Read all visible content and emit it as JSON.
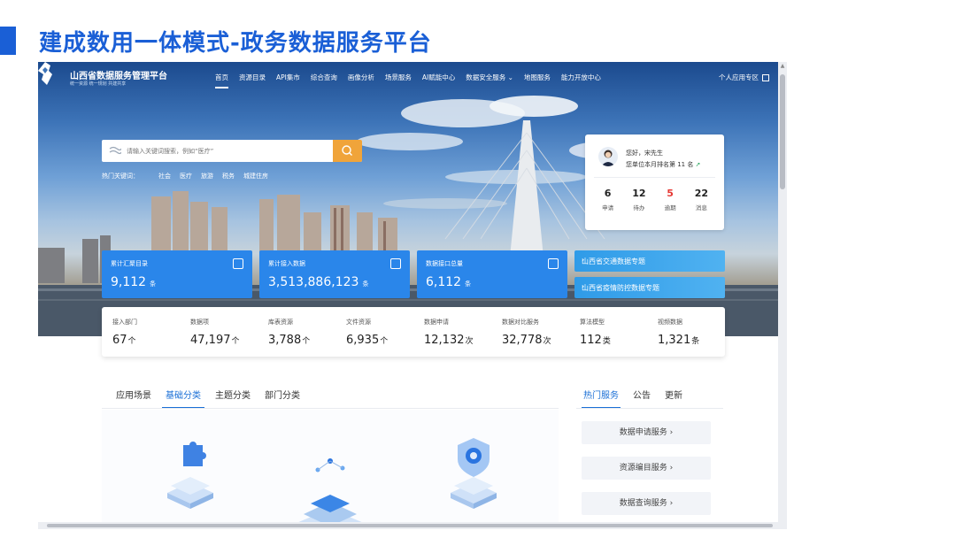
{
  "slide": {
    "title": "建成数用一体模式-政务数据服务平台"
  },
  "app": {
    "name": "山西省数据服务管理平台",
    "slogan": "统一资源 统一规划 共建共享"
  },
  "nav": {
    "items": [
      "首页",
      "资源目录",
      "API集市",
      "综合查询",
      "画像分析",
      "场景服务",
      "AI赋能中心",
      "数据安全服务 ⌄",
      "地图服务",
      "能力开放中心"
    ],
    "active_index": 0,
    "right_label": "个人应用专区"
  },
  "search": {
    "placeholder": "请输入关键词搜索，例如“医疗”",
    "hot_label": "热门关键词：",
    "hot_keywords": [
      "社会",
      "医疗",
      "旅游",
      "税务",
      "城建住房"
    ]
  },
  "user": {
    "greeting": "您好，宋先生",
    "rank_text": "您单位本月排名第 11 名",
    "stats": [
      {
        "value": "6",
        "label": "申请"
      },
      {
        "value": "12",
        "label": "待办"
      },
      {
        "value": "5",
        "label": "逾期"
      },
      {
        "value": "22",
        "label": "消息"
      }
    ]
  },
  "stat_cards": [
    {
      "label": "累计汇聚目录",
      "value": "9,112",
      "unit": "条",
      "icon": "grid-icon"
    },
    {
      "label": "累计接入数据",
      "value": "3,513,886,123",
      "unit": "条",
      "icon": "database-icon"
    },
    {
      "label": "数据接口总量",
      "value": "6,112",
      "unit": "条",
      "icon": "api-icon"
    }
  ],
  "topics": [
    {
      "label": "山西省交通数据专题"
    },
    {
      "label": "山西省疫情防控数据专题"
    }
  ],
  "metrics": [
    {
      "label": "接入部门",
      "value": "67",
      "unit": "个"
    },
    {
      "label": "数据项",
      "value": "47,197",
      "unit": "个"
    },
    {
      "label": "库表资源",
      "value": "3,788",
      "unit": "个"
    },
    {
      "label": "文件资源",
      "value": "6,935",
      "unit": "个"
    },
    {
      "label": "数据申请",
      "value": "12,132",
      "unit": "次"
    },
    {
      "label": "数据对比服务",
      "value": "32,778",
      "unit": "次"
    },
    {
      "label": "算法模型",
      "value": "112",
      "unit": "类"
    },
    {
      "label": "视频数据",
      "value": "1,321",
      "unit": "条"
    }
  ],
  "category_tabs": [
    "应用场景",
    "基础分类",
    "主题分类",
    "部门分类"
  ],
  "category_active_index": 1,
  "right_tabs": [
    "热门服务",
    "公告",
    "更新"
  ],
  "right_active_index": 0,
  "services": [
    "数据申请服务 ›",
    "资源编目服务 ›",
    "数据查询服务 ›"
  ],
  "colors": {
    "primary": "#1a5fd6",
    "card_blue": "#2a86ea",
    "search_button": "#f0a43a",
    "overdue_red": "#e53935"
  }
}
